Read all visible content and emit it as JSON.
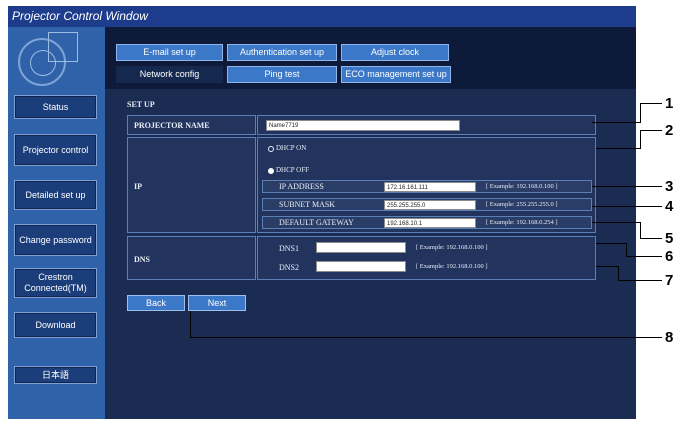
{
  "window": {
    "title": "Projector Control Window"
  },
  "sidebar": {
    "items": [
      {
        "label": "Status"
      },
      {
        "label": "Projector control"
      },
      {
        "label": "Detailed set up"
      },
      {
        "label": "Change password"
      },
      {
        "label": "Crestron Connected(TM)"
      },
      {
        "label": "Download"
      },
      {
        "label": "日本語"
      }
    ]
  },
  "tabs": {
    "row1": [
      "E-mail set up",
      "Authentication set up",
      "Adjust clock"
    ],
    "row2": [
      "Network config",
      "Ping test",
      "ECO management set up"
    ],
    "active": "Network config"
  },
  "setup": {
    "title": "SET UP",
    "projector_name_label": "PROJECTOR NAME",
    "projector_name_value": "Name7719",
    "ip_label": "IP",
    "dhcp_on": "DHCP ON",
    "dhcp_off": "DHCP OFF",
    "dhcp_selected": "DHCP OFF",
    "ip_address_label": "IP ADDRESS",
    "ip_address_value": "172.16.161.111",
    "ip_address_example": "[ Example: 192.168.0.100 ]",
    "subnet_mask_label": "SUBNET MASK",
    "subnet_mask_value": "255.255.255.0",
    "subnet_mask_example": "[ Example: 255.255.255.0 ]",
    "gateway_label": "DEFAULT GATEWAY",
    "gateway_value": "192.168.10.1",
    "gateway_example": "[ Example: 192.168.0.254 ]",
    "dns_label": "DNS",
    "dns1_label": "DNS1",
    "dns1_value": "",
    "dns1_example": "[ Example: 192.168.0.100 ]",
    "dns2_label": "DNS2",
    "dns2_value": "",
    "dns2_example": "[ Example: 192.168.0.100 ]"
  },
  "buttons": {
    "back": "Back",
    "next": "Next"
  },
  "callouts": [
    "1",
    "2",
    "3",
    "4",
    "5",
    "6",
    "7",
    "8"
  ],
  "colors": {
    "titlebar": "#1d3c8c",
    "sidebar": "#2f62a8",
    "content": "#1a2c52",
    "tab": "#3c78c8"
  }
}
